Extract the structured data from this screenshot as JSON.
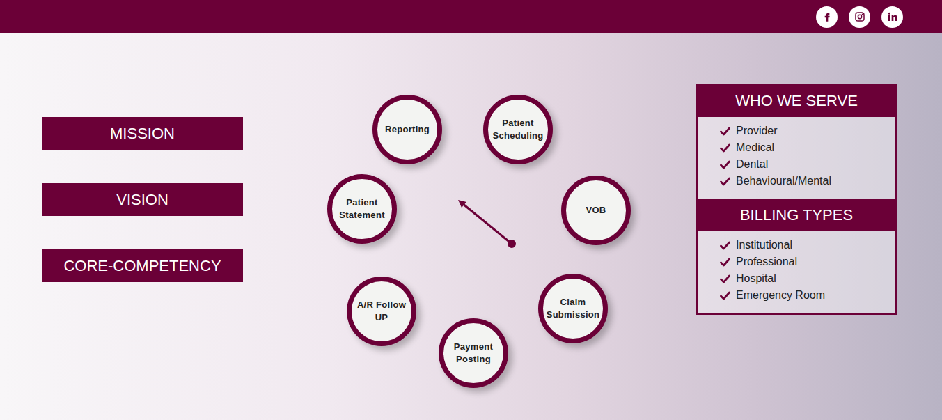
{
  "nav_buttons": [
    "MISSION",
    "VISION",
    "CORE-COMPETENCY"
  ],
  "services": [
    {
      "label": "Reporting"
    },
    {
      "label": "Patient Scheduling"
    },
    {
      "label": "VOB"
    },
    {
      "label": "Claim Submission"
    },
    {
      "label": "Payment Posting"
    },
    {
      "label": "A/R Follow UP"
    },
    {
      "label": "Patient Statement"
    }
  ],
  "panels": [
    {
      "title": "WHO WE SERVE",
      "items": [
        "Provider",
        "Medical",
        "Dental",
        "Behavioural/Mental"
      ]
    },
    {
      "title": "BILLING TYPES",
      "items": [
        "Institutional",
        "Professional",
        "Hospital",
        "Emergency Room"
      ]
    }
  ]
}
